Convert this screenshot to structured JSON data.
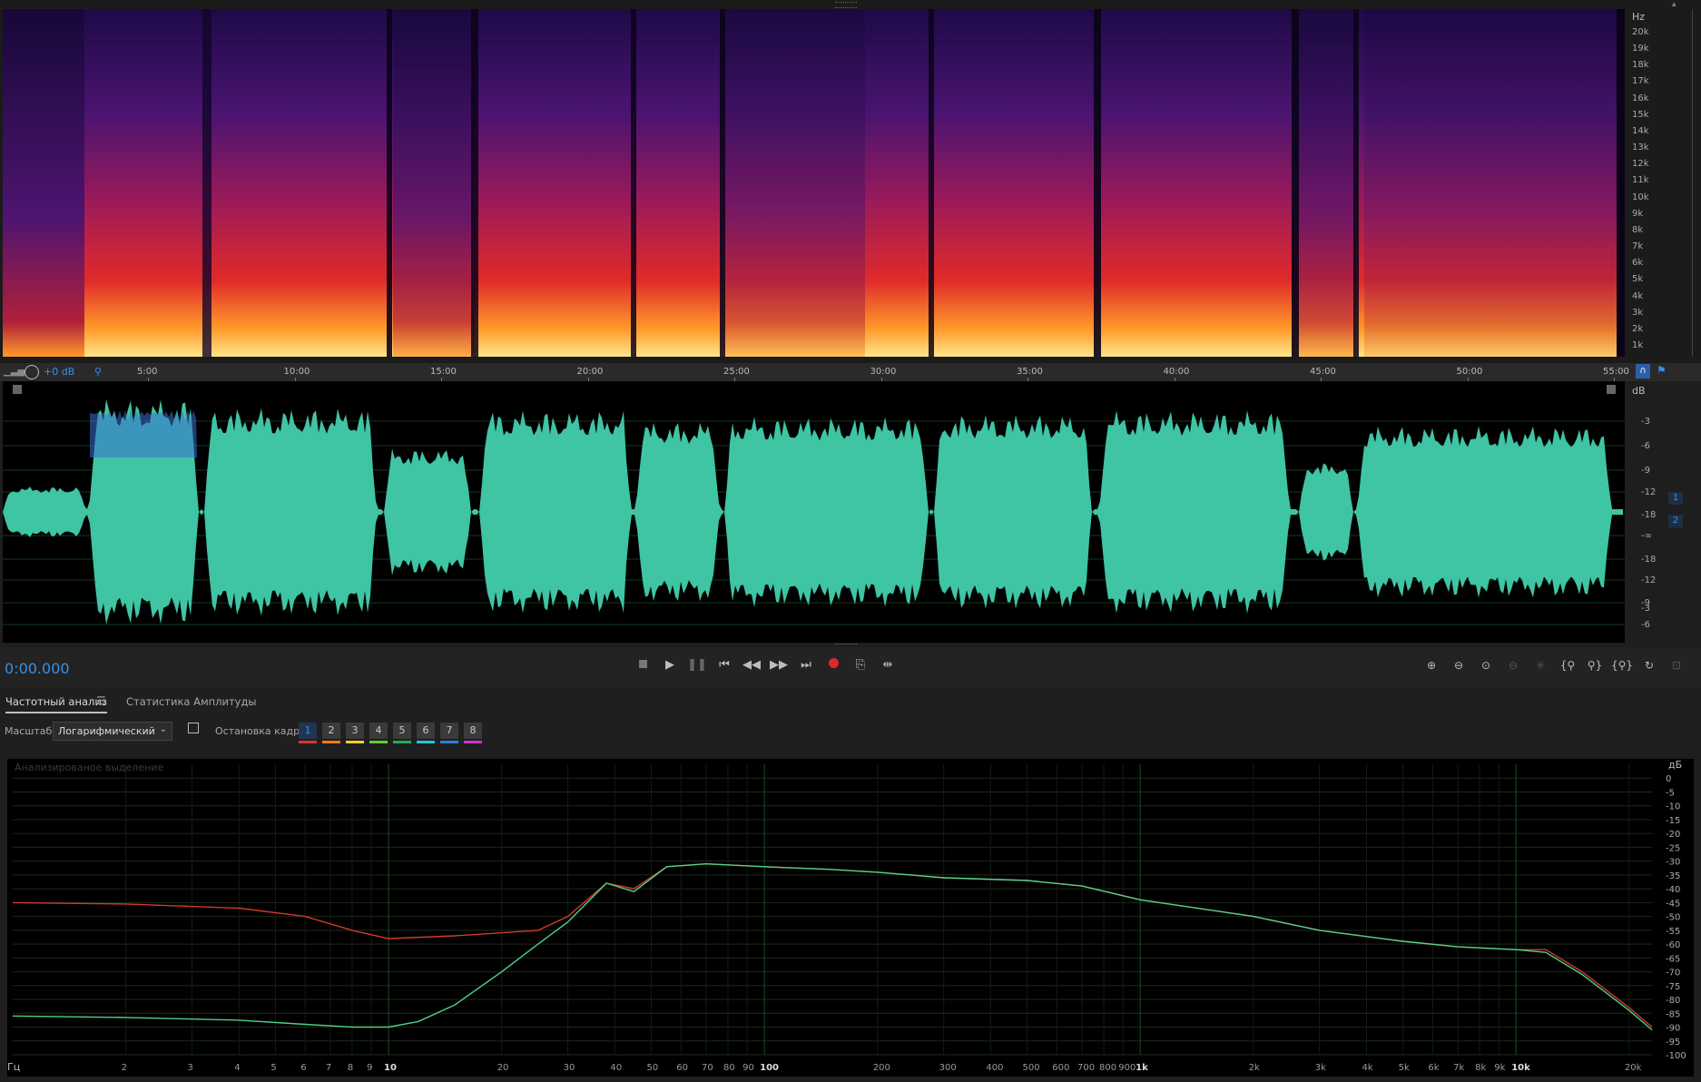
{
  "spectral": {
    "hz_unit": "Hz",
    "freq_labels": [
      "20k",
      "19k",
      "18k",
      "17k",
      "16k",
      "15k",
      "14k",
      "13k",
      "12k",
      "11k",
      "10k",
      "9k",
      "8k",
      "7k",
      "6k",
      "5k",
      "4k",
      "3k",
      "2k",
      "1k"
    ]
  },
  "timeline": {
    "gain_label": "+0 dB",
    "time_labels": [
      "5:00",
      "10:00",
      "15:00",
      "20:00",
      "25:00",
      "30:00",
      "35:00",
      "40:00",
      "45:00",
      "50:00",
      "55:00"
    ]
  },
  "waveform": {
    "db_unit": "dB",
    "db_top": [
      "-3",
      "-6",
      "-9",
      "-12",
      "-18",
      "-∞"
    ],
    "db_bottom": [
      "-18",
      "-12",
      "-9",
      "-6",
      "-3"
    ],
    "channels": [
      "1",
      "2"
    ],
    "color": "#3fc4a4"
  },
  "transport": {
    "time": "0:00.000"
  },
  "panel": {
    "tab_freq": "Частотный анализ",
    "tab_amp": "Статистика Амплитуды"
  },
  "options": {
    "scale_label": "Масштаб:",
    "scale_value": "Логарифмический",
    "freeze_label": "Остановка кадра:",
    "frames": [
      {
        "n": "1",
        "color": "#e03030"
      },
      {
        "n": "2",
        "color": "#f07a18"
      },
      {
        "n": "3",
        "color": "#f0d020"
      },
      {
        "n": "4",
        "color": "#60d030"
      },
      {
        "n": "5",
        "color": "#20b050"
      },
      {
        "n": "6",
        "color": "#20c8d8"
      },
      {
        "n": "7",
        "color": "#2880e8"
      },
      {
        "n": "8",
        "color": "#d830d8"
      }
    ]
  },
  "chart_data": {
    "type": "line",
    "title": "Анализированое выделение",
    "xlabel": "Гц",
    "ylabel": "дБ",
    "x_scale": "log",
    "xlim": [
      1,
      23000
    ],
    "ylim": [
      -100,
      5
    ],
    "x_ticks": [
      {
        "v": 2,
        "t": "2"
      },
      {
        "v": 3,
        "t": "3"
      },
      {
        "v": 4,
        "t": "4"
      },
      {
        "v": 5,
        "t": "5"
      },
      {
        "v": 6,
        "t": "6"
      },
      {
        "v": 7,
        "t": "7"
      },
      {
        "v": 8,
        "t": "8"
      },
      {
        "v": 9,
        "t": "9"
      },
      {
        "v": 10,
        "t": "10",
        "major": true
      },
      {
        "v": 20,
        "t": "20"
      },
      {
        "v": 30,
        "t": "30"
      },
      {
        "v": 40,
        "t": "40"
      },
      {
        "v": 50,
        "t": "50"
      },
      {
        "v": 60,
        "t": "60"
      },
      {
        "v": 70,
        "t": "70"
      },
      {
        "v": 80,
        "t": "80"
      },
      {
        "v": 90,
        "t": "90"
      },
      {
        "v": 100,
        "t": "100",
        "major": true
      },
      {
        "v": 200,
        "t": "200"
      },
      {
        "v": 300,
        "t": "300"
      },
      {
        "v": 400,
        "t": "400"
      },
      {
        "v": 500,
        "t": "500"
      },
      {
        "v": 600,
        "t": "600"
      },
      {
        "v": 700,
        "t": "700"
      },
      {
        "v": 800,
        "t": "800"
      },
      {
        "v": 900,
        "t": "900"
      },
      {
        "v": 1000,
        "t": "1k",
        "major": true
      },
      {
        "v": 2000,
        "t": "2k"
      },
      {
        "v": 3000,
        "t": "3k"
      },
      {
        "v": 4000,
        "t": "4k"
      },
      {
        "v": 5000,
        "t": "5k"
      },
      {
        "v": 6000,
        "t": "6k"
      },
      {
        "v": 7000,
        "t": "7k"
      },
      {
        "v": 8000,
        "t": "8k"
      },
      {
        "v": 9000,
        "t": "9k"
      },
      {
        "v": 10000,
        "t": "10k",
        "major": true
      },
      {
        "v": 20000,
        "t": "20k"
      }
    ],
    "y_ticks": [
      0,
      -5,
      -10,
      -15,
      -20,
      -25,
      -30,
      -35,
      -40,
      -45,
      -50,
      -55,
      -60,
      -65,
      -70,
      -75,
      -80,
      -85,
      -90,
      -95,
      -100
    ],
    "series": [
      {
        "color": "#d03a2a",
        "x": [
          1,
          2,
          4,
          6,
          8,
          10,
          15,
          25,
          30,
          38,
          45,
          55,
          70,
          100,
          150,
          200,
          300,
          500,
          700,
          1000,
          2000,
          3000,
          5000,
          7000,
          10000,
          12000,
          15000,
          20000,
          23000
        ],
        "y": [
          -45,
          -45.5,
          -47,
          -50,
          -55,
          -58,
          -57,
          -55,
          -50,
          -38,
          -40,
          -32,
          -31,
          -32,
          -33,
          -34,
          -36,
          -37,
          -39,
          -44,
          -50,
          -55,
          -59,
          -61,
          -62,
          -62,
          -70,
          -83,
          -90
        ]
      },
      {
        "color": "#4fd08a",
        "x": [
          1,
          2,
          4,
          6,
          8,
          10,
          12,
          15,
          20,
          25,
          30,
          38,
          45,
          55,
          70,
          100,
          150,
          200,
          300,
          500,
          700,
          1000,
          2000,
          3000,
          5000,
          7000,
          10000,
          12000,
          15000,
          20000,
          23000
        ],
        "y": [
          -86,
          -86.5,
          -87.5,
          -89,
          -90,
          -90,
          -88,
          -82,
          -70,
          -60,
          -52,
          -38,
          -41,
          -32,
          -31,
          -32,
          -33,
          -34,
          -36,
          -37,
          -39,
          -44,
          -50,
          -55,
          -59,
          -61,
          -62,
          -63,
          -71,
          -84,
          -91
        ]
      }
    ]
  }
}
